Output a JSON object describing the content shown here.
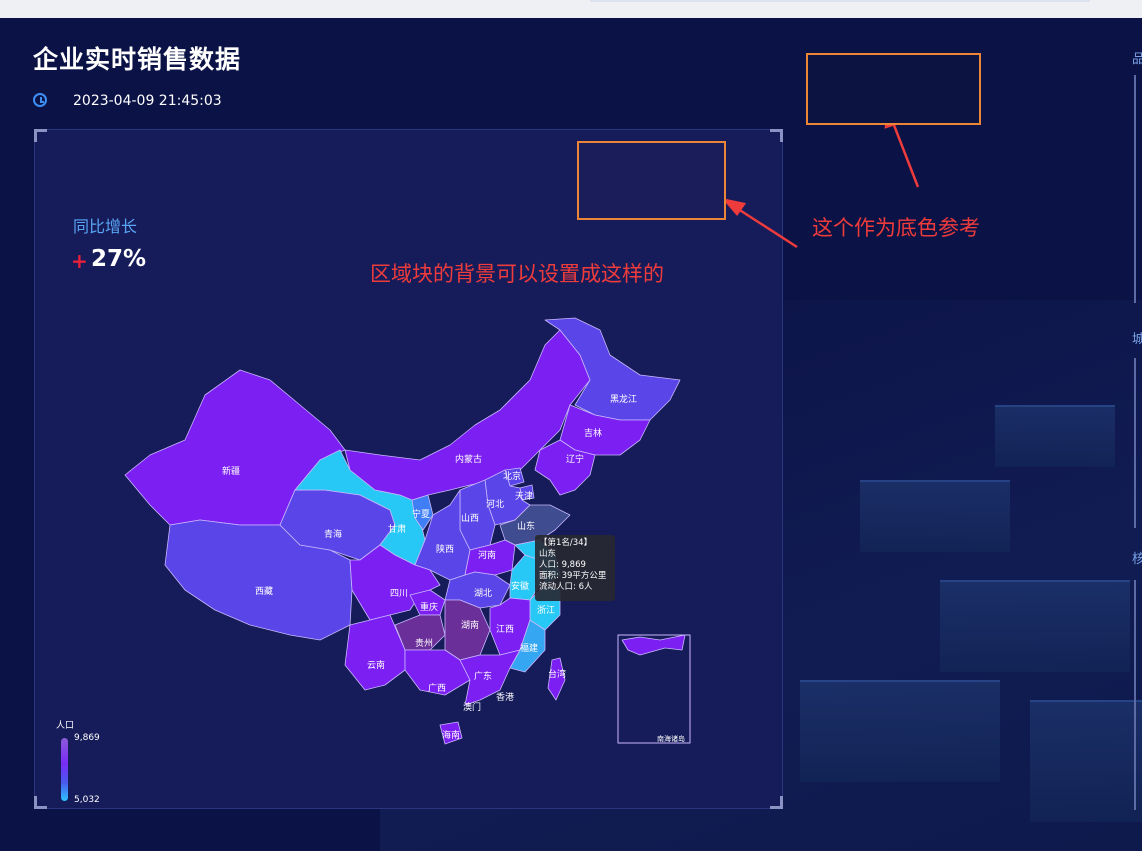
{
  "header": {
    "title": "企业实时销售数据",
    "datetime": "2023-04-09 21:45:03"
  },
  "kpi": {
    "label": "同比增长",
    "sign": "+",
    "value": "27%"
  },
  "annotations": {
    "region_bg_note": "区域块的背景可以设置成这样的",
    "base_color_note": "这个作为底色参考"
  },
  "map": {
    "provinces": {
      "xinjiang": "新疆",
      "xizang": "西藏",
      "qinghai": "青海",
      "gansu": "甘肃",
      "ningxia": "宁夏",
      "neimenggu": "内蒙古",
      "heilongjiang": "黑龙江",
      "jilin": "吉林",
      "liaoning": "辽宁",
      "beijing": "北京",
      "tianjin": "天津",
      "hebei": "河北",
      "shanxi": "山西",
      "shandong": "山东",
      "shaanxi": "陕西",
      "henan": "河南",
      "sichuan": "四川",
      "chongqing": "重庆",
      "hubei": "湖北",
      "anhui": "安徽",
      "jiangsu": "江苏",
      "zhejiang": "浙江",
      "guizhou": "贵州",
      "hunan": "湖南",
      "jiangxi": "江西",
      "fujian": "福建",
      "yunnan": "云南",
      "guangxi": "广西",
      "guangdong": "广东",
      "taiwan": "台湾",
      "xianggang": "香港",
      "aomen": "澳门",
      "hainan": "海南"
    },
    "south_sea_label": "南海诸岛",
    "tooltip": {
      "rank": "【第1名/34】",
      "name": "山东",
      "population": "人口: 9,869",
      "area": "面积: 39平方公里",
      "floating": "流动人口: 6人"
    },
    "legend": {
      "title": "人口",
      "max": "9,869",
      "min": "5,032"
    },
    "colors": {
      "violet": "#7b1ff3",
      "indigo": "#5a45e8",
      "slate": "#3f4c8f",
      "cyan": "#27c8f5",
      "sky": "#34a6f2",
      "plum": "#6b2f9a",
      "dark": "#2e3560"
    }
  },
  "right_panels": {
    "labels": [
      "品",
      "城",
      "核"
    ]
  }
}
